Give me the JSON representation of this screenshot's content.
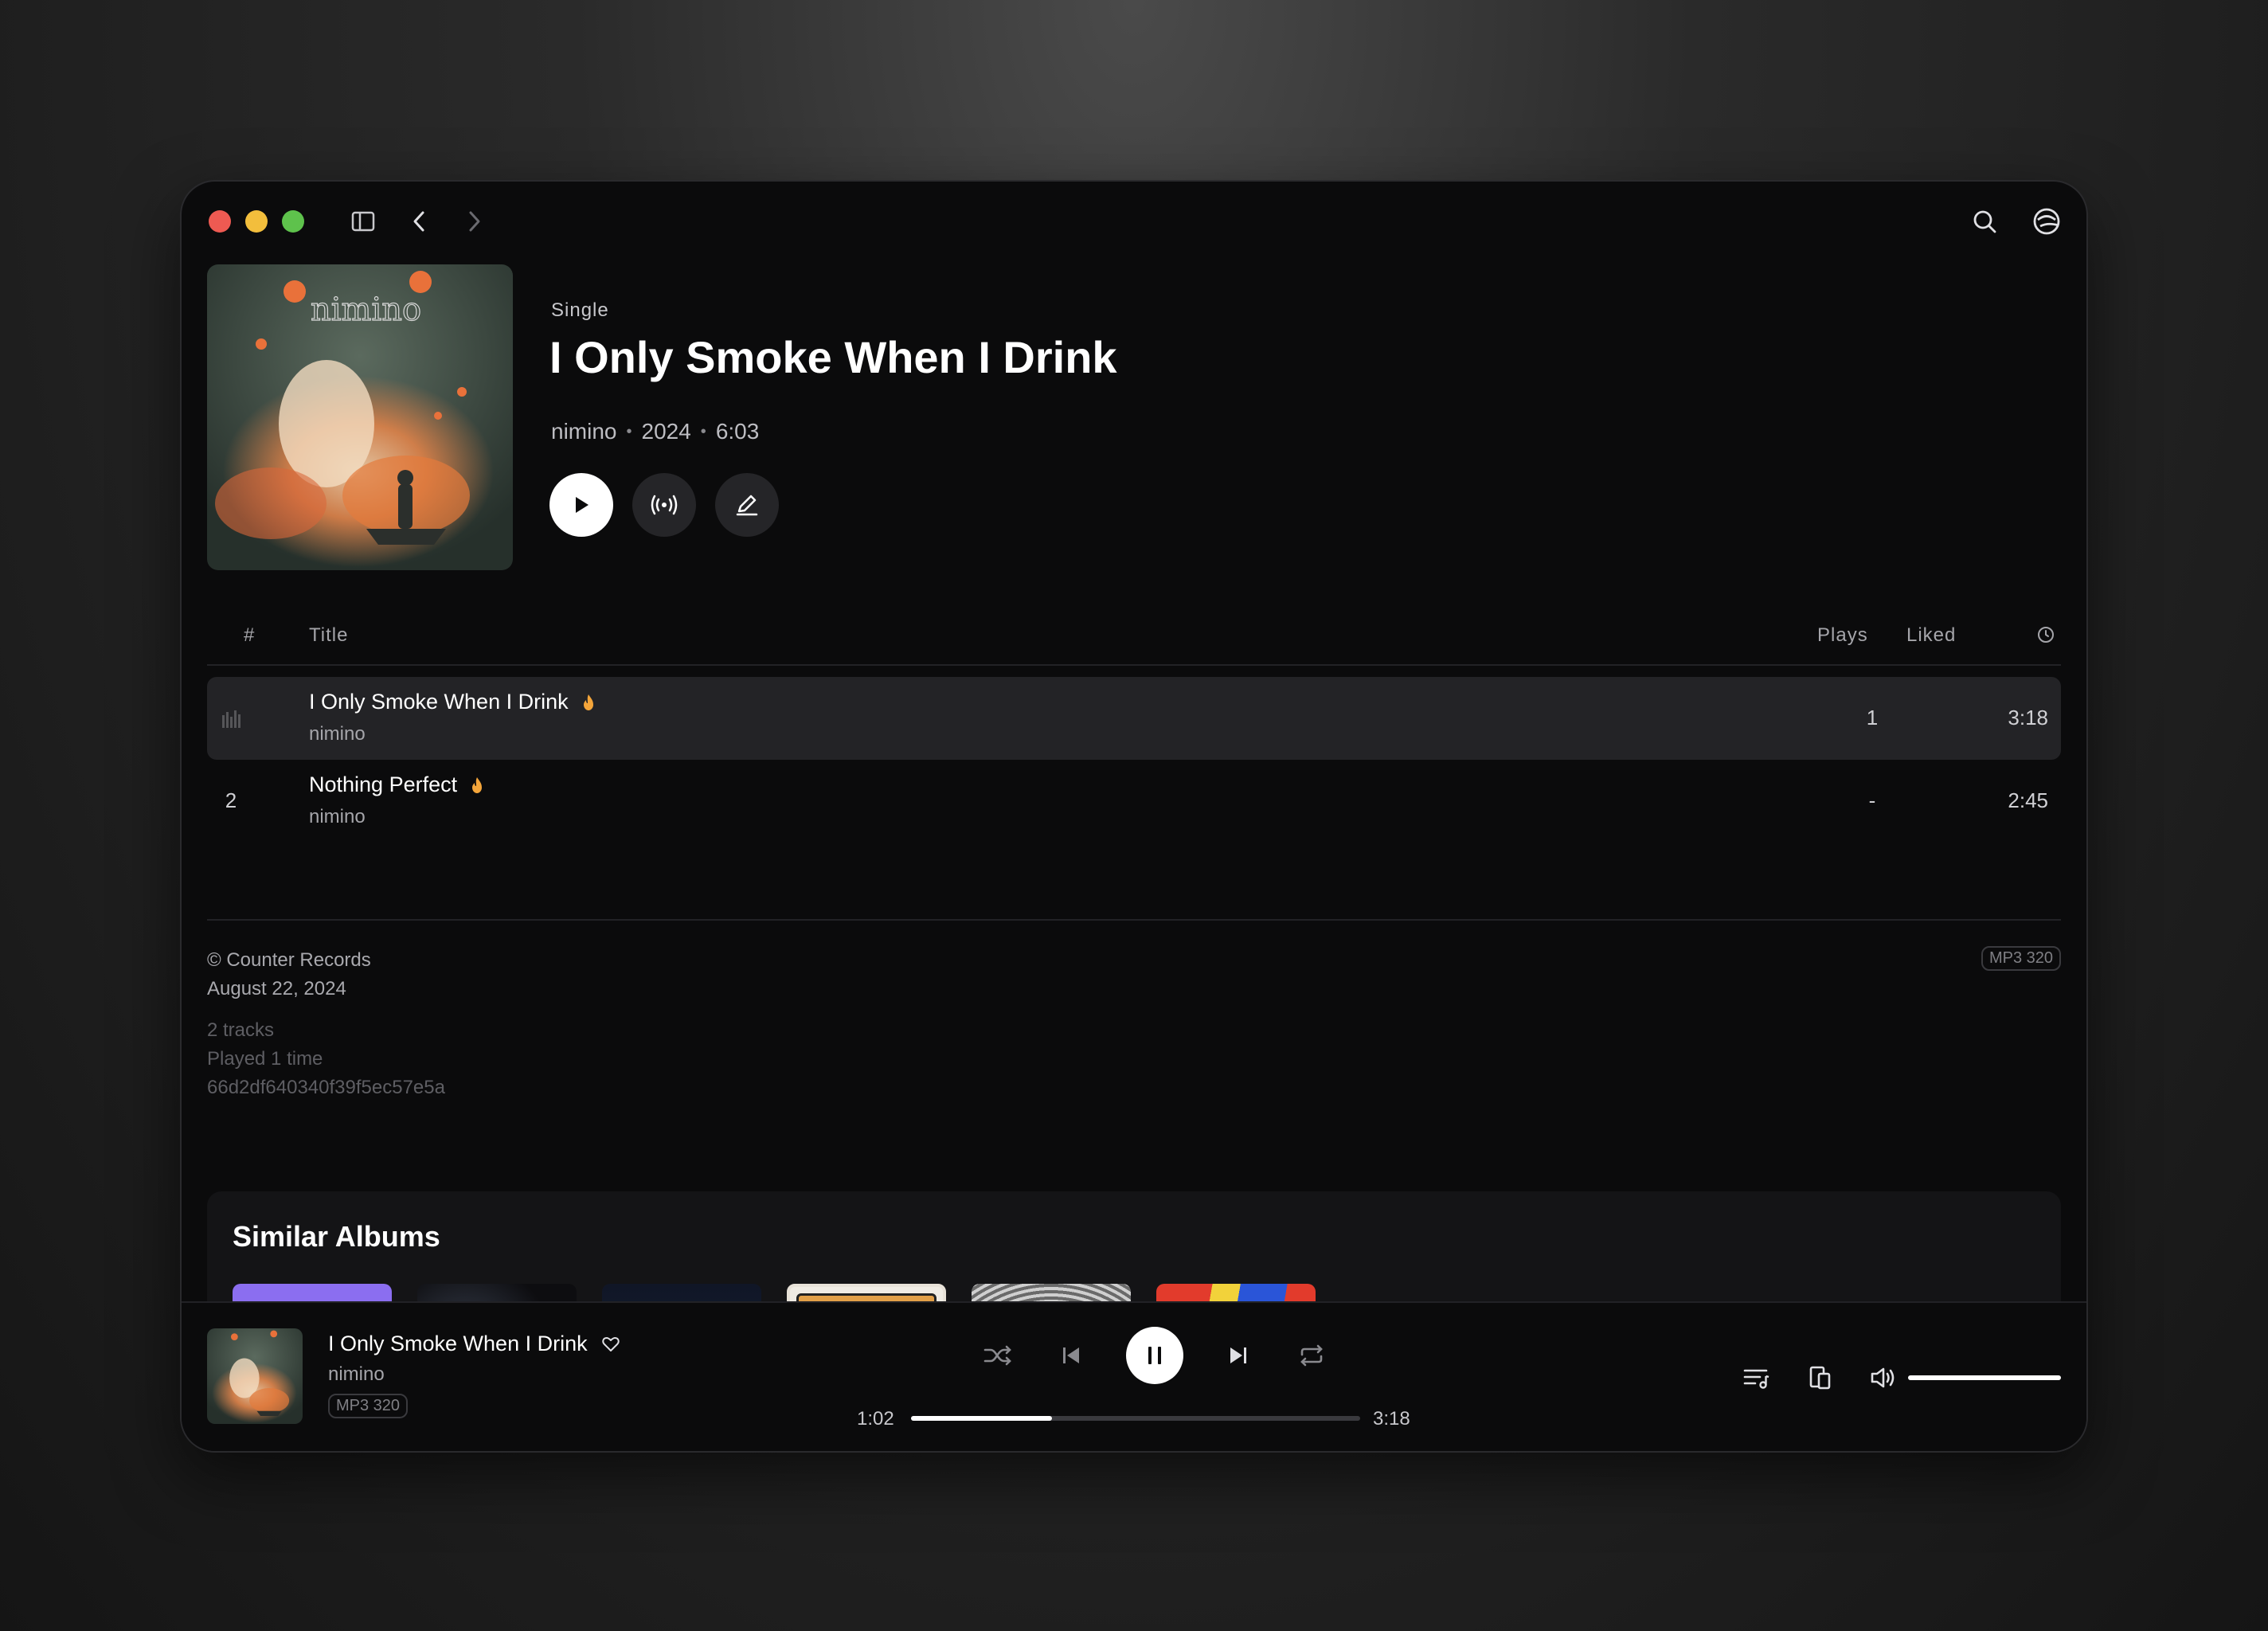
{
  "header": {
    "album_type": "Single",
    "title": "I Only Smoke When I Drink",
    "artist": "nimino",
    "year": "2024",
    "duration": "6:03",
    "cover_text": "nimino"
  },
  "table": {
    "col_number": "#",
    "col_title": "Title",
    "col_plays": "Plays",
    "col_liked": "Liked",
    "col_duration_icon": "clock-icon",
    "tracks": [
      {
        "number": "",
        "title": "I Only Smoke When I Drink",
        "artist": "nimino",
        "plays": "1",
        "duration": "3:18",
        "hot": true
      },
      {
        "number": "2",
        "title": "Nothing Perfect",
        "artist": "nimino",
        "plays": "-",
        "duration": "2:45",
        "hot": true
      }
    ]
  },
  "info": {
    "label": "© Counter Records",
    "release_date": "August 22, 2024",
    "track_count": "2 tracks",
    "played": "Played 1 time",
    "hash": "66d2df640340f39f5ec57e5a",
    "quality": "MP3 320"
  },
  "similar": {
    "title": "Similar Albums"
  },
  "player": {
    "title": "I Only Smoke When I Drink",
    "artist": "nimino",
    "quality": "MP3 320",
    "elapsed": "1:02",
    "total": "3:18",
    "progress": 0.313,
    "volume": 1.0
  },
  "colors": {
    "accent_flame": "#f4a53a",
    "background": "#0b0b0c",
    "active_row": "#232326"
  }
}
